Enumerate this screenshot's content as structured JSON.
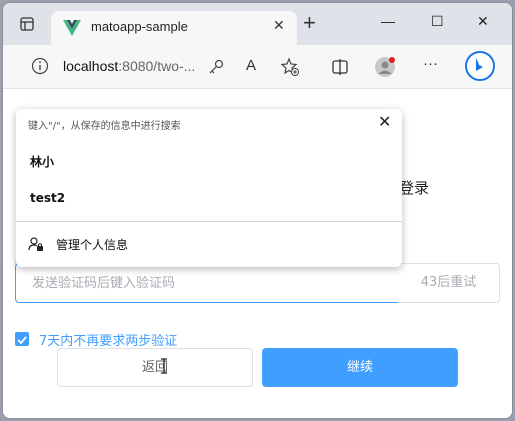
{
  "browser": {
    "tab_title": "matoapp-sample",
    "tab_close": "✕",
    "new_tab": "+",
    "url_host": "localhost",
    "url_rest": ":8080/two-...",
    "read_aloud": "A",
    "window_controls": {
      "minimize": "—",
      "maximize": "☐",
      "close": "✕"
    },
    "more": "···",
    "colors": {
      "vue_green": "#41b883",
      "vue_dark": "#35495e",
      "bing_blue": "#1a73e8"
    }
  },
  "autofill": {
    "header": "键入\"/\"，从保存的信息中进行搜索",
    "close": "✕",
    "items": [
      "林小",
      "test2"
    ],
    "manage": "管理个人信息"
  },
  "page": {
    "login_partial": "登录",
    "code_placeholder": "发送验证码后键入验证码",
    "retry_label": "43后重试",
    "remember_label": "7天内不再要求两步验证",
    "remember_checked": true,
    "back_label": "返回",
    "continue_label": "继续",
    "accent": "#409eff"
  }
}
